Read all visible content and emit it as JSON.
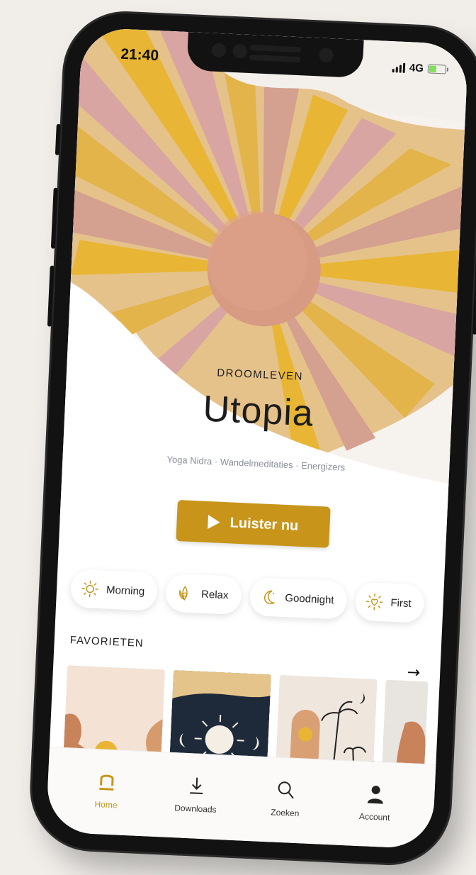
{
  "status": {
    "time": "21:40",
    "network": "4G"
  },
  "hero": {
    "eyebrow": "DROOMLEVEN",
    "title": "Utopia",
    "subtitle": "Yoga Nidra · Wandelmeditaties · Energizers",
    "cta_label": "Luister nu"
  },
  "chips": [
    {
      "label": "Morning",
      "icon": "sun-icon"
    },
    {
      "label": "Relax",
      "icon": "lotus-icon"
    },
    {
      "label": "Goodnight",
      "icon": "moon-icon"
    },
    {
      "label": "First",
      "icon": "sun-heart-icon"
    }
  ],
  "favorites": {
    "label": "FAVORIETEN",
    "arrow": "→"
  },
  "tabs": [
    {
      "label": "Home",
      "icon": "home-icon",
      "active": true
    },
    {
      "label": "Downloads",
      "icon": "download-icon",
      "active": false
    },
    {
      "label": "Zoeken",
      "icon": "search-icon",
      "active": false
    },
    {
      "label": "Account",
      "icon": "account-icon",
      "active": false
    }
  ],
  "colors": {
    "accent": "#c8951a",
    "background": "#f1eeea",
    "subtitle": "#8b8f9a"
  }
}
